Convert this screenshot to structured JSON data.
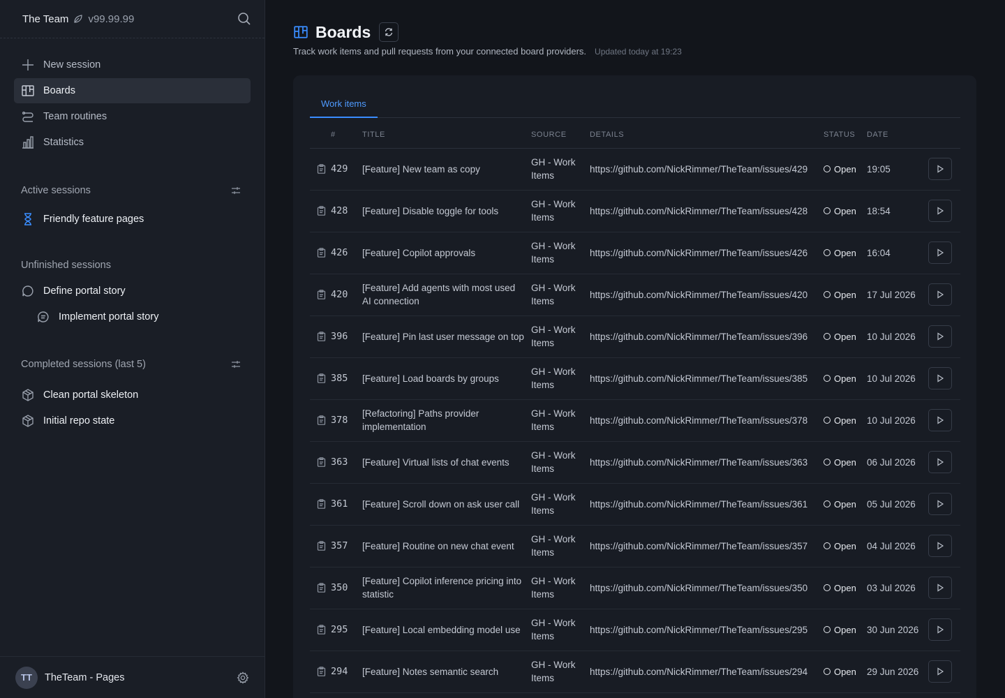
{
  "app": {
    "name": "The Team",
    "version": "v99.99.99"
  },
  "nav": [
    {
      "label": "New session",
      "icon": "plus-icon"
    },
    {
      "label": "Boards",
      "icon": "boards-icon",
      "active": true
    },
    {
      "label": "Team routines",
      "icon": "routine-icon"
    },
    {
      "label": "Statistics",
      "icon": "chart-icon"
    }
  ],
  "active_sessions": {
    "title": "Active sessions",
    "items": [
      {
        "label": "Friendly feature pages",
        "icon": "hourglass-icon"
      }
    ]
  },
  "unfinished_sessions": {
    "title": "Unfinished sessions",
    "items": [
      {
        "label": "Define portal story",
        "icon": "chat-bubble-icon"
      },
      {
        "label": "Implement portal story",
        "icon": "chat-lines-icon"
      }
    ]
  },
  "completed_sessions": {
    "title": "Completed sessions (last 5)",
    "items": [
      {
        "label": "Clean portal skeleton",
        "icon": "package-icon"
      },
      {
        "label": "Initial repo state",
        "icon": "package-icon"
      }
    ]
  },
  "footer": {
    "avatar_initials": "TT",
    "workspace": "TheTeam - Pages"
  },
  "page": {
    "title": "Boards",
    "subtitle": "Track work items and pull requests from your connected board providers.",
    "updated": "Updated today at 19:23",
    "tabs": [
      "Work items"
    ]
  },
  "table": {
    "columns": {
      "num": "#",
      "title": "TITLE",
      "source": "SOURCE",
      "details": "DETAILS",
      "status": "STATUS",
      "date": "DATE"
    },
    "rows": [
      {
        "num": "429",
        "title": "[Feature] New team as copy",
        "source": "GH - Work Items",
        "details": "https://github.com/NickRimmer/TheTeam/issues/429",
        "status": "Open",
        "date": "19:05"
      },
      {
        "num": "428",
        "title": "[Feature] Disable toggle for tools",
        "source": "GH - Work Items",
        "details": "https://github.com/NickRimmer/TheTeam/issues/428",
        "status": "Open",
        "date": "18:54"
      },
      {
        "num": "426",
        "title": "[Feature] Copilot approvals",
        "source": "GH - Work Items",
        "details": "https://github.com/NickRimmer/TheTeam/issues/426",
        "status": "Open",
        "date": "16:04"
      },
      {
        "num": "420",
        "title": "[Feature] Add agents with most used AI connection",
        "source": "GH - Work Items",
        "details": "https://github.com/NickRimmer/TheTeam/issues/420",
        "status": "Open",
        "date": "17 Jul 2026"
      },
      {
        "num": "396",
        "title": "[Feature] Pin last user message on top",
        "source": "GH - Work Items",
        "details": "https://github.com/NickRimmer/TheTeam/issues/396",
        "status": "Open",
        "date": "10 Jul 2026"
      },
      {
        "num": "385",
        "title": "[Feature] Load boards by groups",
        "source": "GH - Work Items",
        "details": "https://github.com/NickRimmer/TheTeam/issues/385",
        "status": "Open",
        "date": "10 Jul 2026"
      },
      {
        "num": "378",
        "title": "[Refactoring] Paths provider implementation",
        "source": "GH - Work Items",
        "details": "https://github.com/NickRimmer/TheTeam/issues/378",
        "status": "Open",
        "date": "10 Jul 2026"
      },
      {
        "num": "363",
        "title": "[Feature] Virtual lists of chat events",
        "source": "GH - Work Items",
        "details": "https://github.com/NickRimmer/TheTeam/issues/363",
        "status": "Open",
        "date": "06 Jul 2026"
      },
      {
        "num": "361",
        "title": "[Feature] Scroll down on ask user call",
        "source": "GH - Work Items",
        "details": "https://github.com/NickRimmer/TheTeam/issues/361",
        "status": "Open",
        "date": "05 Jul 2026"
      },
      {
        "num": "357",
        "title": "[Feature] Routine on new chat event",
        "source": "GH - Work Items",
        "details": "https://github.com/NickRimmer/TheTeam/issues/357",
        "status": "Open",
        "date": "04 Jul 2026"
      },
      {
        "num": "350",
        "title": "[Feature] Copilot inference pricing into statistic",
        "source": "GH - Work Items",
        "details": "https://github.com/NickRimmer/TheTeam/issues/350",
        "status": "Open",
        "date": "03 Jul 2026"
      },
      {
        "num": "295",
        "title": "[Feature] Local embedding model use",
        "source": "GH - Work Items",
        "details": "https://github.com/NickRimmer/TheTeam/issues/295",
        "status": "Open",
        "date": "30 Jun 2026"
      },
      {
        "num": "294",
        "title": "[Feature] Notes semantic search",
        "source": "GH - Work Items",
        "details": "https://github.com/NickRimmer/TheTeam/issues/294",
        "status": "Open",
        "date": "29 Jun 2026"
      }
    ]
  },
  "colors": {
    "accent": "#3a8dff",
    "sidebar_bg": "#1a1e26",
    "main_bg": "#12151b",
    "card_bg": "#181c24"
  }
}
